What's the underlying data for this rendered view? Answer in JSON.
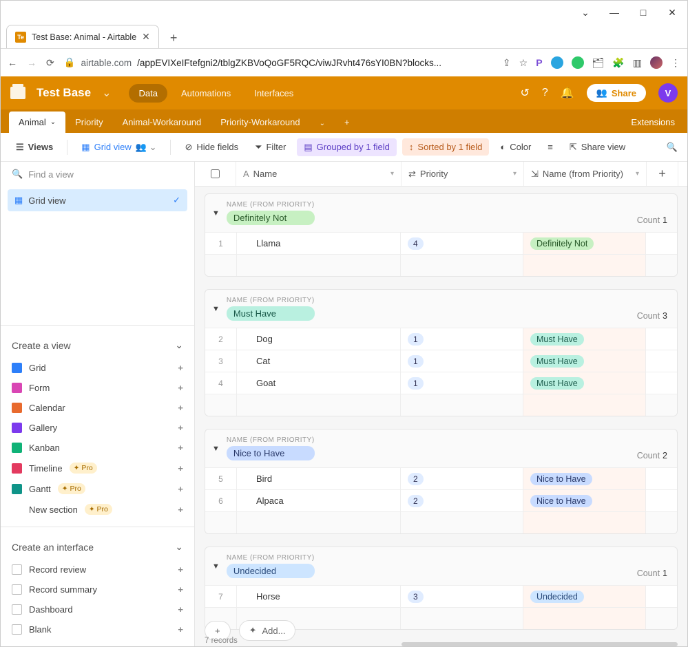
{
  "browser": {
    "tab_title": "Test Base: Animal - Airtable",
    "favicon_text": "Te",
    "url_host": "airtable.com",
    "url_path": "/appEVIXeIFtefgni2/tblgZKBVoQoGF5RQC/viwJRvht476sYI0BN?blocks..."
  },
  "appbar": {
    "base_name": "Test Base",
    "tabs": [
      "Data",
      "Automations",
      "Interfaces"
    ],
    "share_label": "Share",
    "avatar_letter": "V"
  },
  "table_tabs": {
    "items": [
      "Animal",
      "Priority",
      "Animal-Workaround",
      "Priority-Workaround"
    ],
    "extensions_label": "Extensions"
  },
  "toolbar": {
    "views_label": "Views",
    "gridview_label": "Grid view",
    "hidefields_label": "Hide fields",
    "filter_label": "Filter",
    "grouped_label": "Grouped by 1 field",
    "sorted_label": "Sorted by 1 field",
    "color_label": "Color",
    "share_label": "Share view"
  },
  "sidebar": {
    "search_placeholder": "Find a view",
    "active_view": "Grid view",
    "create_title": "Create a view",
    "create_items": [
      {
        "label": "Grid",
        "color": "#2d7ff9",
        "pro": false
      },
      {
        "label": "Form",
        "color": "#d946b4",
        "pro": false
      },
      {
        "label": "Calendar",
        "color": "#e86a2e",
        "pro": false
      },
      {
        "label": "Gallery",
        "color": "#7c3aed",
        "pro": false
      },
      {
        "label": "Kanban",
        "color": "#10b277",
        "pro": false
      },
      {
        "label": "Timeline",
        "color": "#e33a5f",
        "pro": true
      },
      {
        "label": "Gantt",
        "color": "#0f9488",
        "pro": true
      },
      {
        "label": "New section",
        "color": "",
        "pro": true
      }
    ],
    "pro_badge": "Pro",
    "interface_title": "Create an interface",
    "interface_items": [
      {
        "label": "Record review"
      },
      {
        "label": "Record summary"
      },
      {
        "label": "Dashboard"
      },
      {
        "label": "Blank"
      }
    ]
  },
  "columns": {
    "name": "Name",
    "priority": "Priority",
    "lookup": "Name (from Priority)"
  },
  "group_field_label": "NAME (FROM PRIORITY)",
  "count_label": "Count",
  "groups": [
    {
      "pill": "Definitely Not",
      "pill_class": "pill-green",
      "count": "1",
      "rows": [
        {
          "n": "1",
          "name": "Llama",
          "priority": "4",
          "lookup": "Definitely Not",
          "lookup_class": "pill-green"
        }
      ]
    },
    {
      "pill": "Must Have",
      "pill_class": "pill-teal",
      "count": "3",
      "rows": [
        {
          "n": "2",
          "name": "Dog",
          "priority": "1",
          "lookup": "Must Have",
          "lookup_class": "pill-teal"
        },
        {
          "n": "3",
          "name": "Cat",
          "priority": "1",
          "lookup": "Must Have",
          "lookup_class": "pill-teal"
        },
        {
          "n": "4",
          "name": "Goat",
          "priority": "1",
          "lookup": "Must Have",
          "lookup_class": "pill-teal"
        }
      ]
    },
    {
      "pill": "Nice to Have",
      "pill_class": "pill-blue",
      "count": "2",
      "rows": [
        {
          "n": "5",
          "name": "Bird",
          "priority": "2",
          "lookup": "Nice to Have",
          "lookup_class": "pill-blue"
        },
        {
          "n": "6",
          "name": "Alpaca",
          "priority": "2",
          "lookup": "Nice to Have",
          "lookup_class": "pill-blue"
        }
      ]
    },
    {
      "pill": "Undecided",
      "pill_class": "pill-lblue",
      "count": "1",
      "rows": [
        {
          "n": "7",
          "name": "Horse",
          "priority": "3",
          "lookup": "Undecided",
          "lookup_class": "pill-lblue"
        }
      ]
    }
  ],
  "footer": {
    "add_label": "Add...",
    "records_label": "7 records"
  }
}
